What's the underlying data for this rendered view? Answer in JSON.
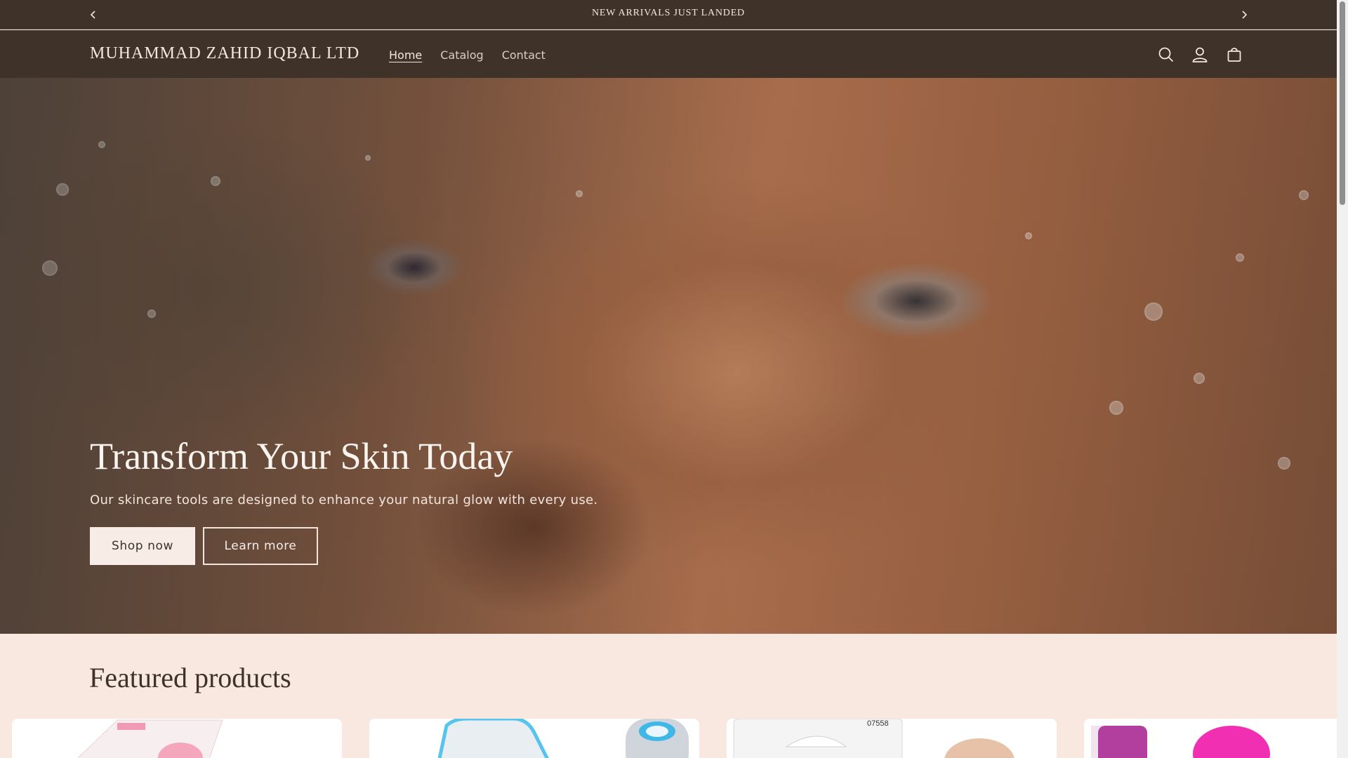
{
  "announcement": {
    "message": "NEW ARRIVALS JUST LANDED",
    "prev_icon": "chevron-left-icon",
    "next_icon": "chevron-right-icon"
  },
  "header": {
    "logo": "MUHAMMAD ZAHID IQBAL LTD",
    "nav": [
      {
        "label": "Home",
        "active": true
      },
      {
        "label": "Catalog",
        "active": false
      },
      {
        "label": "Contact",
        "active": false
      }
    ],
    "icons": [
      "search-icon",
      "account-icon",
      "cart-icon"
    ]
  },
  "hero": {
    "title": "Transform Your Skin Today",
    "subtitle": "Our skincare tools are designed to enhance your natural glow with every use.",
    "primary_button": "Shop now",
    "secondary_button": "Learn more"
  },
  "featured": {
    "title": "Featured products",
    "products": [
      {
        "image": "pink-facial-brush-box"
      },
      {
        "image": "blue-led-face-device"
      },
      {
        "image": "silicone-sponge-pack"
      },
      {
        "image": "derma-roller-and-pink-brush"
      }
    ]
  },
  "colors": {
    "header_bg": "#3e3229",
    "page_bg": "#f8e8df",
    "text_light": "#f3e7df",
    "button_bg": "#f8ece6"
  }
}
